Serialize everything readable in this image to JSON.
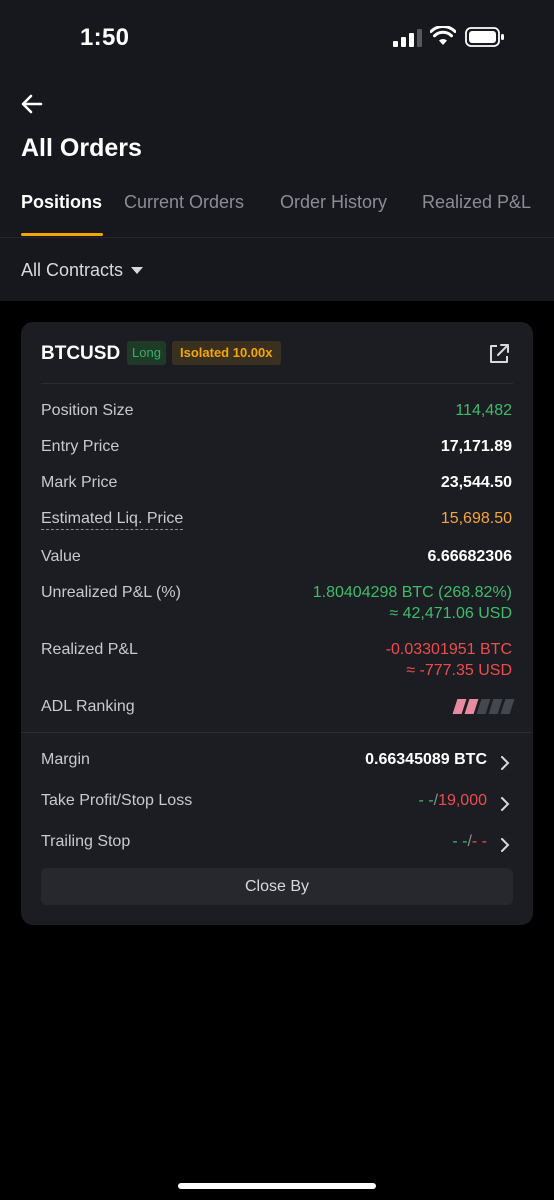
{
  "status": {
    "time": "1:50"
  },
  "header": {
    "title": "All Orders",
    "tabs": [
      {
        "label": "Positions",
        "active": true
      },
      {
        "label": "Current Orders",
        "active": false
      },
      {
        "label": "Order History",
        "active": false
      },
      {
        "label": "Realized P&L",
        "active": false
      }
    ],
    "filter": "All Contracts"
  },
  "position": {
    "symbol": "BTCUSD",
    "side": "Long",
    "margin_mode": "Isolated 10.00x",
    "rows": {
      "size_label": "Position Size",
      "size_value": "114,482",
      "entry_label": "Entry Price",
      "entry_value": "17,171.89",
      "mark_label": "Mark Price",
      "mark_value": "23,544.50",
      "liq_label": "Estimated Liq. Price",
      "liq_value": "15,698.50",
      "value_label": "Value",
      "value_value": "6.66682306",
      "upnl_label": "Unrealized P&L (%)",
      "upnl_value": "1.80404298 BTC (268.82%)",
      "upnl_usd": "≈ 42,471.06 USD",
      "rpnl_label": "Realized P&L",
      "rpnl_value": "-0.03301951 BTC",
      "rpnl_usd": "≈ -777.35 USD",
      "adl_label": "ADL Ranking",
      "adl_level": 2,
      "adl_max": 5
    },
    "margin_label": "Margin",
    "margin_value": "0.66345089 BTC",
    "tpsl_label": "Take Profit/Stop Loss",
    "tpsl_tp": "- -",
    "tpsl_sep": "/",
    "tpsl_sl": "19,000",
    "trailing_label": "Trailing Stop",
    "trailing_a": "- -",
    "trailing_sep": "/",
    "trailing_b": "- -",
    "close_label": "Close By"
  },
  "colors": {
    "accent": "#f7a600",
    "green": "#3cbd6a",
    "red": "#ee4c4c",
    "orange": "#f5a53a"
  }
}
